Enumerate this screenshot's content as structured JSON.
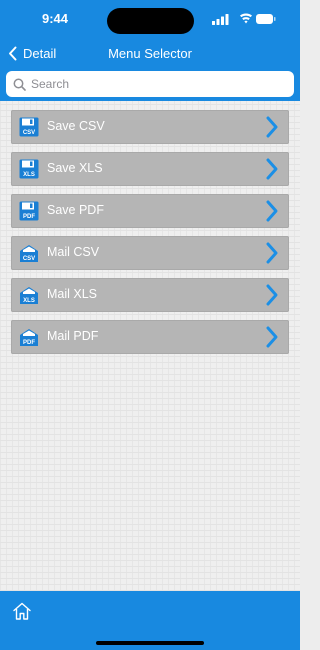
{
  "status_bar": {
    "time": "9:44"
  },
  "nav": {
    "back_label": "Detail",
    "title": "Menu Selector"
  },
  "search": {
    "placeholder": "Search"
  },
  "menu": {
    "items": [
      {
        "label": "Save CSV",
        "badge": "CSV",
        "kind": "save-icon"
      },
      {
        "label": "Save XLS",
        "badge": "XLS",
        "kind": "save-icon"
      },
      {
        "label": "Save PDF",
        "badge": "PDF",
        "kind": "save-icon"
      },
      {
        "label": "Mail CSV",
        "badge": "CSV",
        "kind": "mail-icon"
      },
      {
        "label": "Mail XLS",
        "badge": "XLS",
        "kind": "mail-icon"
      },
      {
        "label": "Mail PDF",
        "badge": "PDF",
        "kind": "mail-icon"
      }
    ]
  },
  "colors": {
    "accent": "#1889e0",
    "row": "#b5b5b5",
    "chevron": "#1b8fe6"
  },
  "tabbar": {
    "icon": "home-icon"
  }
}
